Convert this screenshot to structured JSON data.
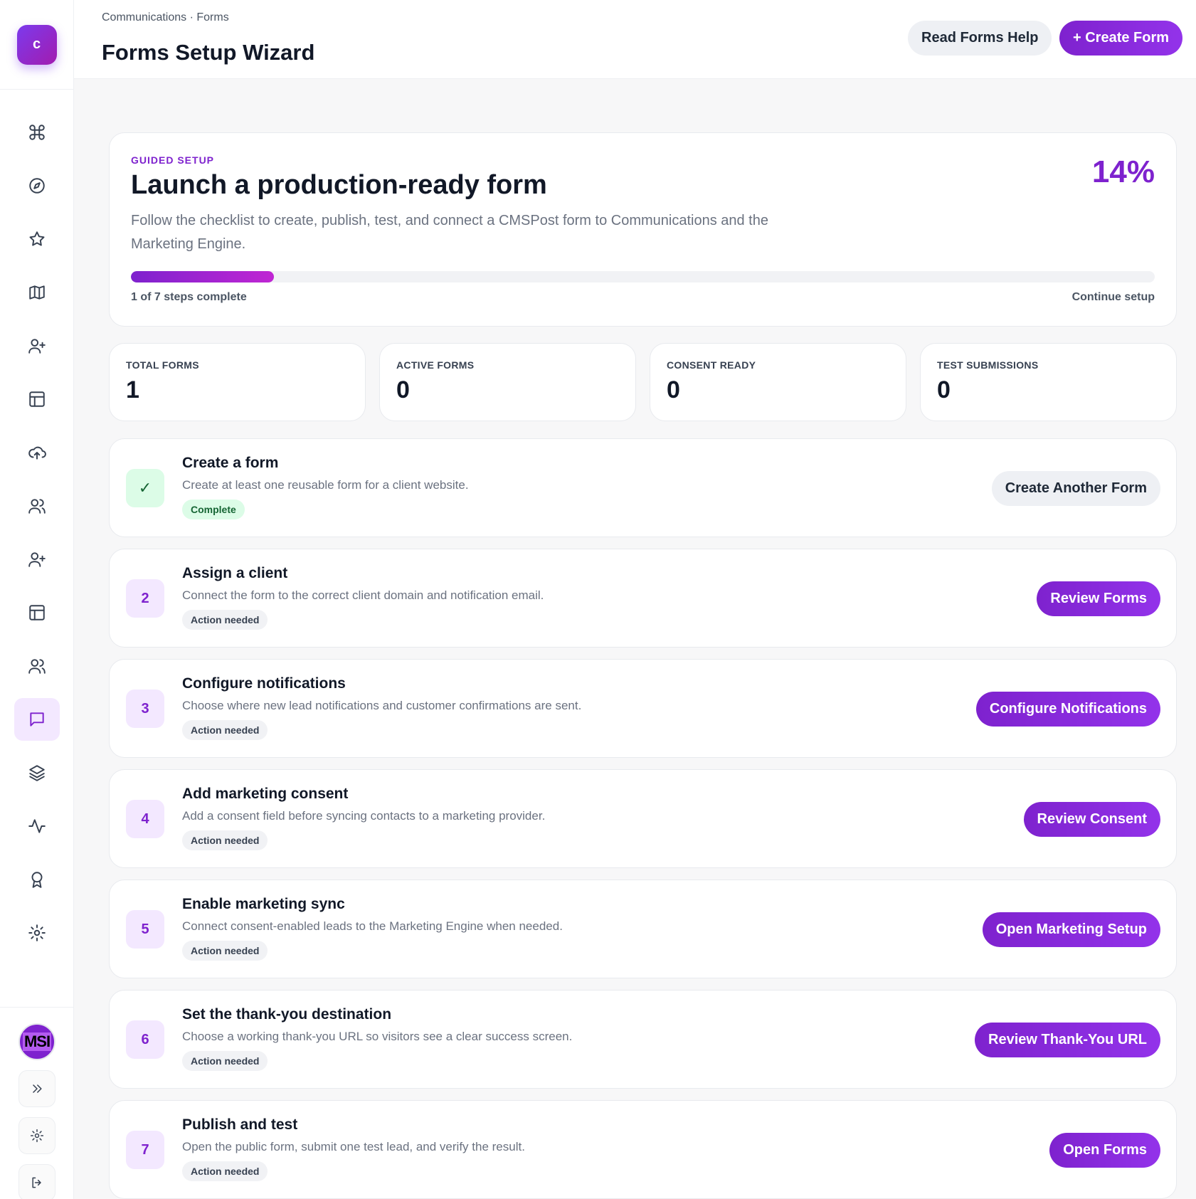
{
  "app": {
    "logo_letter": "c"
  },
  "header": {
    "breadcrumb": "Communications · Forms",
    "title": "Forms Setup Wizard",
    "help_label": "Read Forms Help",
    "create_label": "+ Create Form"
  },
  "sidebar": {
    "items": [
      {
        "icon": "command-icon"
      },
      {
        "icon": "compass-icon"
      },
      {
        "icon": "star-icon"
      },
      {
        "icon": "map-icon"
      },
      {
        "icon": "user-plus-icon"
      },
      {
        "icon": "layout-icon"
      },
      {
        "icon": "cloud-upload-icon"
      },
      {
        "icon": "users-icon"
      },
      {
        "icon": "user-plus-icon"
      },
      {
        "icon": "layout-icon"
      },
      {
        "icon": "users-icon"
      },
      {
        "icon": "message-icon",
        "active": true
      },
      {
        "icon": "layers-icon"
      },
      {
        "icon": "activity-icon"
      },
      {
        "icon": "award-icon"
      },
      {
        "icon": "settings-icon"
      }
    ],
    "avatar_text": "MSI"
  },
  "hero": {
    "eyebrow": "GUIDED SETUP",
    "title": "Launch a production-ready form",
    "description": "Follow the checklist to create, publish, test, and connect a CMSPost form to Communications and the Marketing Engine.",
    "percent_label": "14%",
    "progress": 0.14,
    "steps_complete": "1 of 7 steps complete",
    "continue_label": "Continue setup"
  },
  "stats": [
    {
      "label": "TOTAL FORMS",
      "value": "1"
    },
    {
      "label": "ACTIVE FORMS",
      "value": "0"
    },
    {
      "label": "CONSENT READY",
      "value": "0"
    },
    {
      "label": "TEST SUBMISSIONS",
      "value": "0"
    }
  ],
  "steps": [
    {
      "badge": "✓",
      "done": true,
      "title": "Create a form",
      "description": "Create at least one reusable form for a client website.",
      "status": "Complete",
      "action": "Create Another Form"
    },
    {
      "badge": "2",
      "done": false,
      "title": "Assign a client",
      "description": "Connect the form to the correct client domain and notification email.",
      "status": "Action needed",
      "action": "Review Forms"
    },
    {
      "badge": "3",
      "done": false,
      "title": "Configure notifications",
      "description": "Choose where new lead notifications and customer confirmations are sent.",
      "status": "Action needed",
      "action": "Configure Notifications"
    },
    {
      "badge": "4",
      "done": false,
      "title": "Add marketing consent",
      "description": "Add a consent field before syncing contacts to a marketing provider.",
      "status": "Action needed",
      "action": "Review Consent"
    },
    {
      "badge": "5",
      "done": false,
      "title": "Enable marketing sync",
      "description": "Connect consent-enabled leads to the Marketing Engine when needed.",
      "status": "Action needed",
      "action": "Open Marketing Setup"
    },
    {
      "badge": "6",
      "done": false,
      "title": "Set the thank-you destination",
      "description": "Choose a working thank-you URL so visitors see a clear success screen.",
      "status": "Action needed",
      "action": "Review Thank-You URL"
    },
    {
      "badge": "7",
      "done": false,
      "title": "Publish and test",
      "description": "Open the public form, submit one test lead, and verify the result.",
      "status": "Action needed",
      "action": "Open Forms"
    }
  ],
  "colors": {
    "accent": "#7e22ce",
    "accent_soft": "#f3e8ff",
    "success_soft": "#dcfce7",
    "success_text": "#166534"
  }
}
